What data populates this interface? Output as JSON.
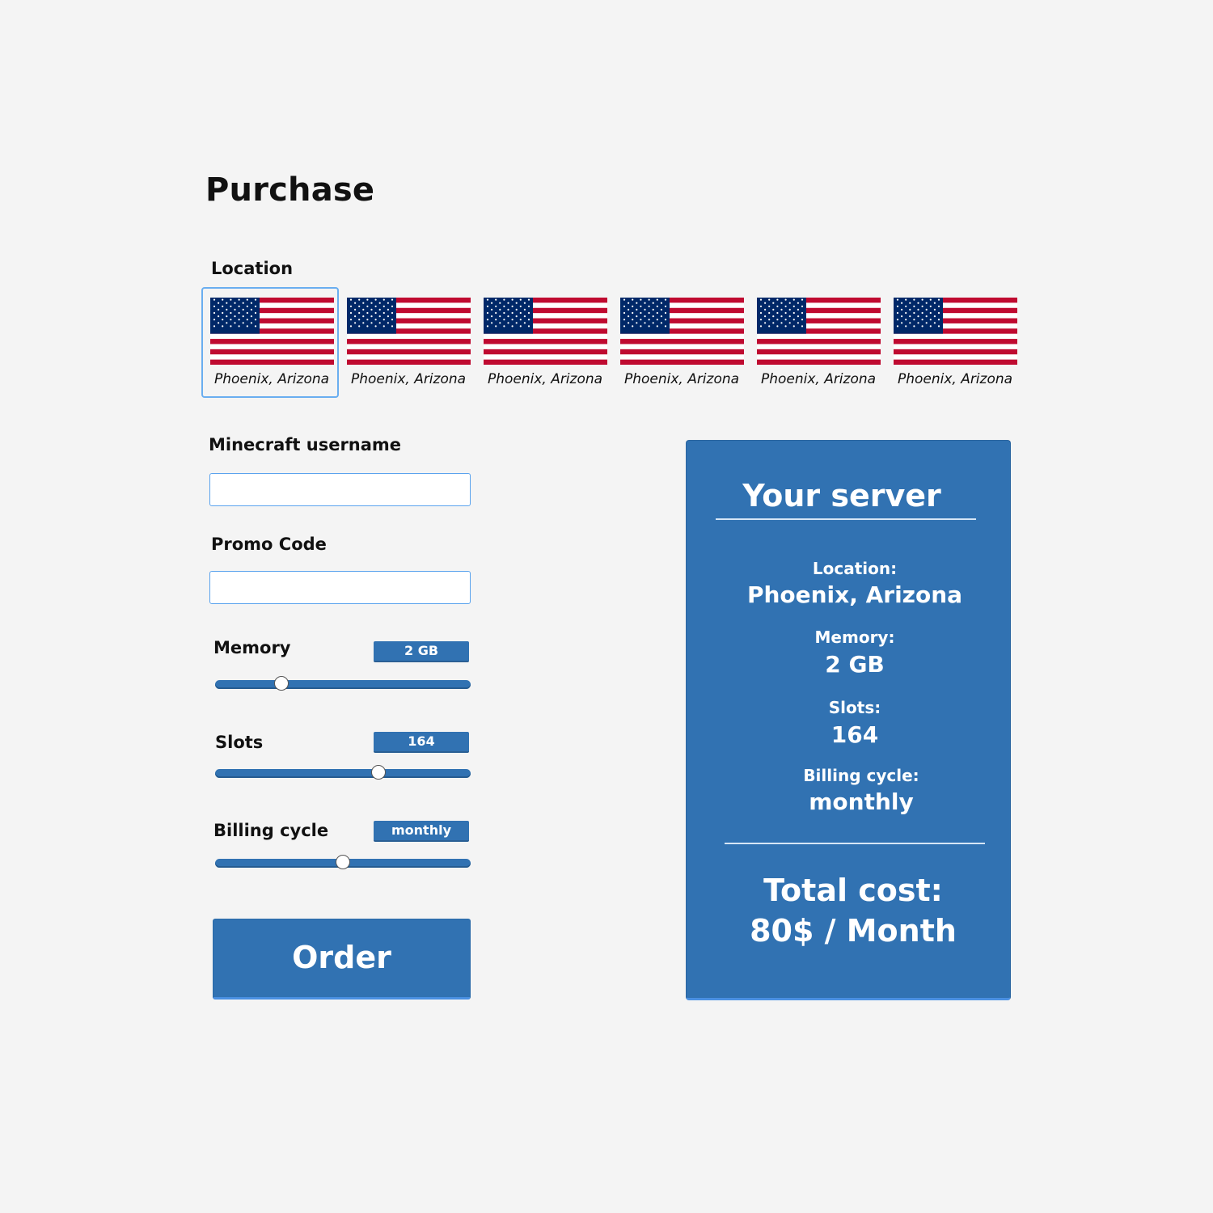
{
  "page": {
    "title": "Purchase"
  },
  "location": {
    "label": "Location",
    "selected_index": 0,
    "options": [
      {
        "name": "Phoenix, Arizona",
        "flag": "us-flag-icon"
      },
      {
        "name": "Phoenix, Arizona",
        "flag": "us-flag-icon"
      },
      {
        "name": "Phoenix, Arizona",
        "flag": "us-flag-icon"
      },
      {
        "name": "Phoenix, Arizona",
        "flag": "us-flag-icon"
      },
      {
        "name": "Phoenix, Arizona",
        "flag": "us-flag-icon"
      },
      {
        "name": "Phoenix, Arizona",
        "flag": "us-flag-icon"
      }
    ]
  },
  "form": {
    "username_label": "Minecraft username",
    "username_value": "",
    "promo_label": "Promo Code",
    "promo_value": ""
  },
  "memory": {
    "label": "Memory",
    "value": "2 GB",
    "fraction": 0.26
  },
  "slots": {
    "label": "Slots",
    "value": "164",
    "fraction": 0.64
  },
  "billing": {
    "label": "Billing cycle",
    "value": "monthly",
    "fraction": 0.5
  },
  "order_button": {
    "label": "Order"
  },
  "summary": {
    "title": "Your server",
    "location_label": "Location:",
    "location_value": "Phoenix, Arizona",
    "memory_label": "Memory:",
    "memory_value": "2 GB",
    "slots_label": "Slots:",
    "slots_value": "164",
    "billing_label": "Billing cycle:",
    "billing_value": "monthly",
    "total_label": "Total cost:",
    "total_value": "80$ / Month"
  },
  "colors": {
    "background": "#f4f4f4",
    "accent": "#3172b2",
    "selected_border": "#6aaef0",
    "flag_red": "#bf0a30",
    "flag_blue": "#002868"
  }
}
